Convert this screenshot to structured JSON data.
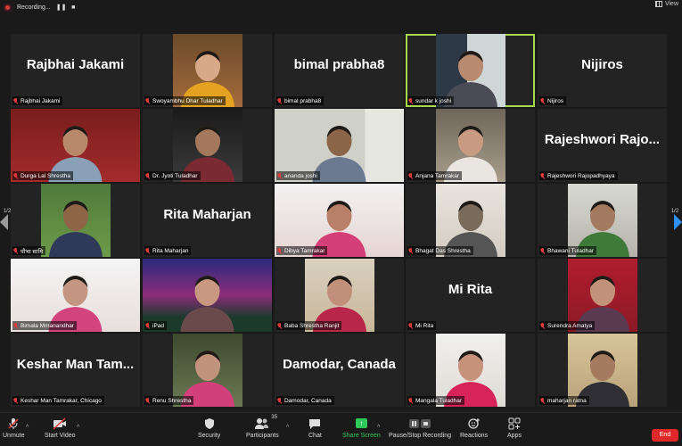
{
  "topbar": {
    "recording_label": "Recording...",
    "view_label": "View"
  },
  "pager": {
    "left": "1/2",
    "right": "1/2"
  },
  "colors": {
    "active_speaker_outline": "#a5d84a",
    "end_button": "#e02828",
    "share_screen": "#2ec75a",
    "muted_mic": "#e03c3c"
  },
  "participants": [
    {
      "tag": "Rajbhai Jakami",
      "big_name": "Rajbhai Jakami",
      "video": false,
      "active": false
    },
    {
      "tag": "Swoyambhu Dhar Tuladhar",
      "big_name": "",
      "video": true,
      "active": false
    },
    {
      "tag": "bimal prabha8",
      "big_name": "bimal prabha8",
      "video": false,
      "active": false
    },
    {
      "tag": "sundar k joshi",
      "big_name": "",
      "video": true,
      "active": true
    },
    {
      "tag": "Nijiros",
      "big_name": "Nijiros",
      "video": false,
      "active": false
    },
    {
      "tag": "Durga Lal Shrestha",
      "big_name": "",
      "video": true,
      "active": false
    },
    {
      "tag": "Dr. Jyoti Tuladhar",
      "big_name": "",
      "video": true,
      "active": false
    },
    {
      "tag": "ananda joshi",
      "big_name": "",
      "video": true,
      "active": false
    },
    {
      "tag": "Anjana Tamrakar",
      "big_name": "",
      "video": true,
      "active": false
    },
    {
      "tag": "Rajeshwori Rajopadhyaya",
      "big_name": "Rajeshwori Rajo...",
      "video": false,
      "active": false
    },
    {
      "tag": "पौभा सामि",
      "big_name": "",
      "video": true,
      "active": false
    },
    {
      "tag": "Rita Maharjan",
      "big_name": "Rita Maharjan",
      "video": false,
      "active": false
    },
    {
      "tag": "Dibya Tamrakar",
      "big_name": "",
      "video": true,
      "active": false
    },
    {
      "tag": "Bhagat Das Shrestha",
      "big_name": "",
      "video": true,
      "active": false
    },
    {
      "tag": "Bhawani Tuladhar",
      "big_name": "",
      "video": true,
      "active": false
    },
    {
      "tag": "Bimala Mmanandhar",
      "big_name": "",
      "video": true,
      "active": false
    },
    {
      "tag": "iPad",
      "big_name": "",
      "video": true,
      "active": false
    },
    {
      "tag": "Baba Shrestha Ranjit",
      "big_name": "",
      "video": true,
      "active": false
    },
    {
      "tag": "Mi Rita",
      "big_name": "Mi Rita",
      "video": false,
      "active": false
    },
    {
      "tag": "Surendra Amatya",
      "big_name": "",
      "video": true,
      "active": false
    },
    {
      "tag": "Keshar Man Tamrakar, Chicago",
      "big_name": "Keshar Man Tam...",
      "video": false,
      "active": false
    },
    {
      "tag": "Renu Shrestha",
      "big_name": "",
      "video": true,
      "active": false
    },
    {
      "tag": "Damodar, Canada",
      "big_name": "Damodar, Canada",
      "video": false,
      "active": false
    },
    {
      "tag": "Mangala Tuladhar",
      "big_name": "",
      "video": true,
      "active": false
    },
    {
      "tag": "maharjan ratna",
      "big_name": "",
      "video": true,
      "active": false
    }
  ],
  "toolbar": {
    "unmute": "Unmute",
    "start_video": "Start Video",
    "security": "Security",
    "participants": "Participants",
    "participants_count": "35",
    "chat": "Chat",
    "share_screen": "Share Screen",
    "pause_recording": "Pause/Stop Recording",
    "reactions": "Reactions",
    "apps": "Apps",
    "end": "End"
  }
}
